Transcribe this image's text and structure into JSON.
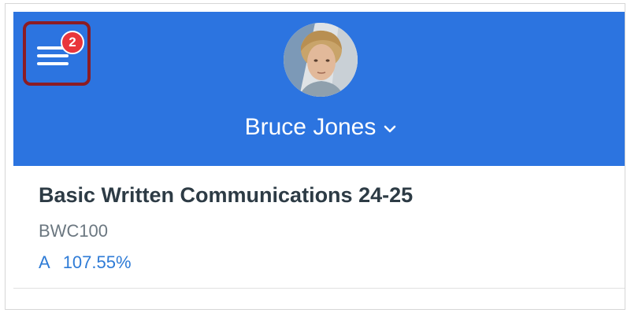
{
  "header": {
    "menu_badge_count": "2",
    "user_name": "Bruce Jones",
    "menu_icon": "hamburger-menu-icon",
    "dropdown_icon": "chevron-down-icon",
    "background_color": "#2c74e0",
    "badge_color": "#e9353b",
    "highlight_color": "#8c1c23"
  },
  "course": {
    "title": "Basic Written Communications 24-25",
    "code": "BWC100",
    "grade_letter": "A",
    "grade_percent": "107.55%",
    "grade_color": "#2e7bd6"
  }
}
